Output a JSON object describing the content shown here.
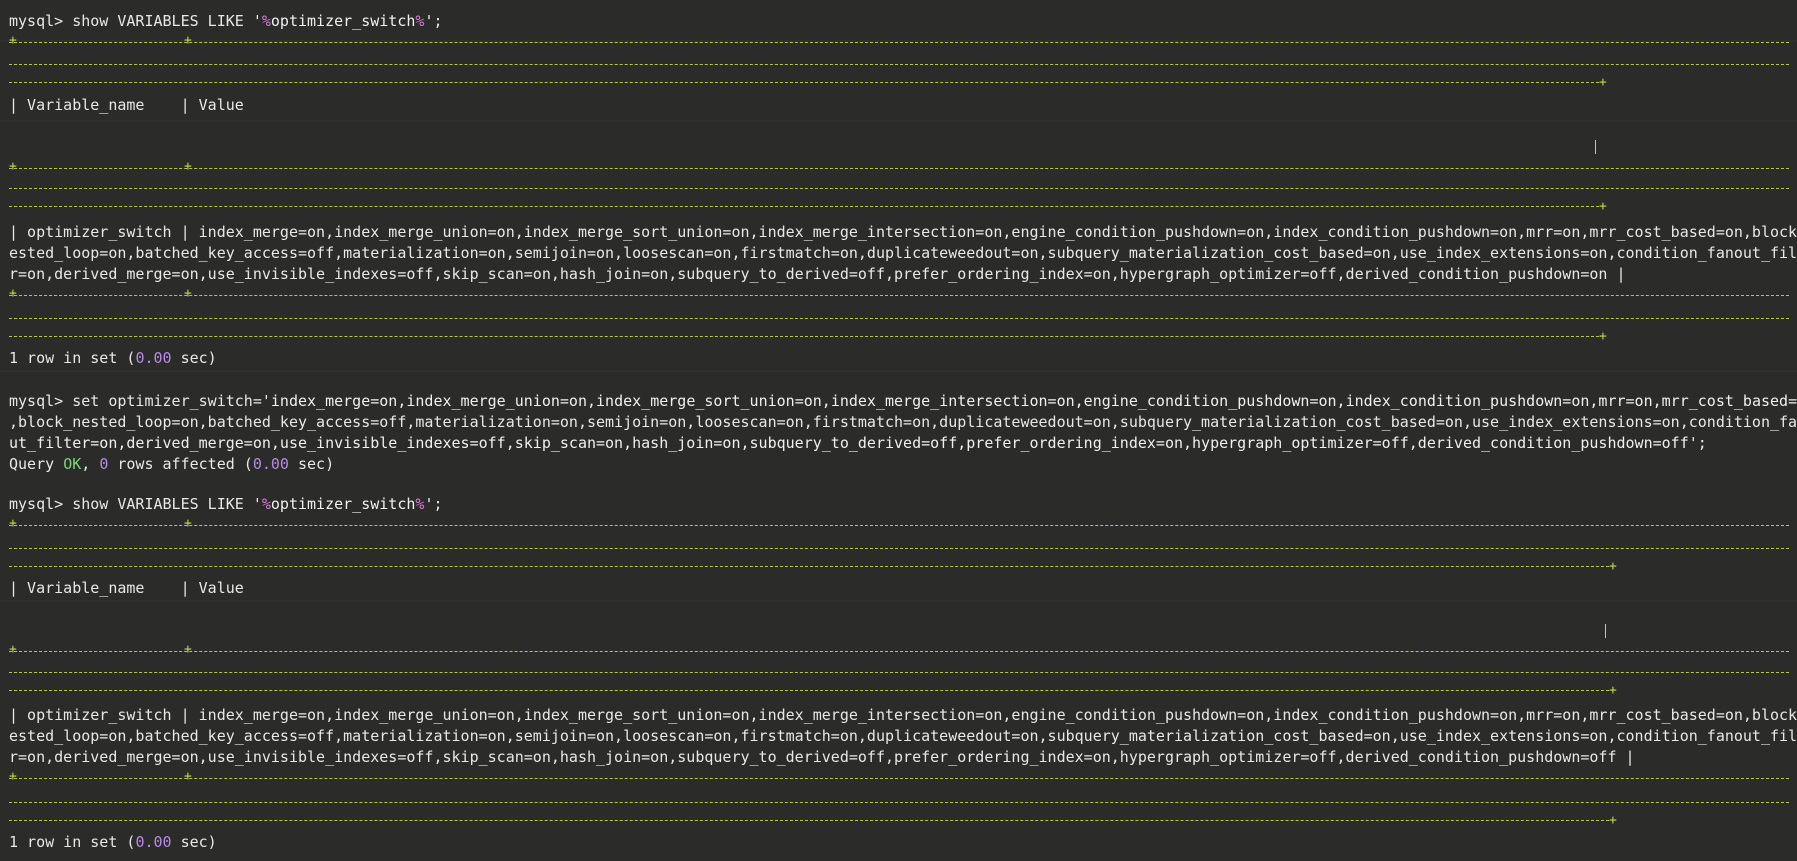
{
  "prompt": "mysql>",
  "query1": {
    "cmd": "show VARIABLES LIKE ",
    "q_open": "'",
    "pct1": "%",
    "pattern": "optimizer_switch",
    "pct2": "%",
    "q_close": "'",
    "end": ";"
  },
  "table1": {
    "header": "| Variable_name    | Value",
    "row_line1": "| optimizer_switch | index_merge=on,index_merge_union=on,index_merge_sort_union=on,index_merge_intersection=on,engine_condition_pushdown=on,index_condition_pushdown=on,mrr=on,mrr_cost_based=on,block_n",
    "row_line2": "ested_loop=on,batched_key_access=off,materialization=on,semijoin=on,loosescan=on,firstmatch=on,duplicateweedout=on,subquery_materialization_cost_based=on,use_index_extensions=on,condition_fanout_filte",
    "row_line3": "r=on,derived_merge=on,use_invisible_indexes=off,skip_scan=on,hash_join=on,subquery_to_derived=off,prefer_ordering_index=on,hypergraph_optimizer=off,derived_condition_pushdown=on |"
  },
  "result1": {
    "pre": "1 row in set (",
    "time": "0.00",
    "post": " sec)"
  },
  "set_cmd": {
    "line1_pre": "set optimizer_switch=",
    "line1_str": "'index_merge=on,index_merge_union=on,index_merge_sort_union=on,index_merge_intersection=on,engine_condition_pushdown=on,index_condition_pushdown=on,mrr=on,mrr_cost_based=on",
    "line2": ",block_nested_loop=on,batched_key_access=off,materialization=on,semijoin=on,loosescan=on,firstmatch=on,duplicateweedout=on,subquery_materialization_cost_based=on,use_index_extensions=on,condition_fano",
    "line3_str": "ut_filter=on,derived_merge=on,use_invisible_indexes=off,skip_scan=on,hash_join=on,subquery_to_derived=off,prefer_ordering_index=on,hypergraph_optimizer=off,derived_condition_pushdown=off'",
    "line3_end": ";"
  },
  "set_result": {
    "pre": "Query ",
    "ok": "OK",
    "mid": ", ",
    "rows": "0",
    "mid2": " rows affected (",
    "time": "0.00",
    "post": " sec)"
  },
  "query2": {
    "cmd": "show VARIABLES LIKE ",
    "q_open": "'",
    "pct1": "%",
    "pattern": "optimizer_switch",
    "pct2": "%",
    "q_close": "'",
    "end": ";"
  },
  "table2": {
    "header": "| Variable_name    | Value",
    "row_line1": "| optimizer_switch | index_merge=on,index_merge_union=on,index_merge_sort_union=on,index_merge_intersection=on,engine_condition_pushdown=on,index_condition_pushdown=on,mrr=on,mrr_cost_based=on,block_n",
    "row_line2": "ested_loop=on,batched_key_access=off,materialization=on,semijoin=on,loosescan=on,firstmatch=on,duplicateweedout=on,subquery_materialization_cost_based=on,use_index_extensions=on,condition_fanout_filte",
    "row_line3": "r=on,derived_merge=on,use_invisible_indexes=off,skip_scan=on,hash_join=on,subquery_to_derived=off,prefer_ordering_index=on,hypergraph_optimizer=off,derived_condition_pushdown=off |"
  },
  "result2": {
    "pre": "1 row in set (",
    "time": "0.00",
    "post": " sec)"
  },
  "colors": {
    "background": "#2b2b2a",
    "text": "#e8e8e8",
    "border": "#b8c93a",
    "percent": "#d87ad8",
    "number": "#b58ae8",
    "ok": "#7ad87a"
  }
}
